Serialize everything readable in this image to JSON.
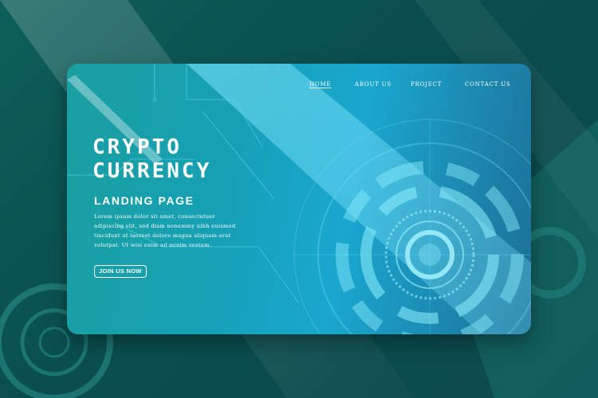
{
  "nav": {
    "items": [
      {
        "label": "HOME",
        "active": true
      },
      {
        "label": "ABOUT US",
        "active": false
      },
      {
        "label": "PROJECT",
        "active": false
      },
      {
        "label": "CONTACT US",
        "active": false
      }
    ]
  },
  "hero": {
    "title_line1": "CRYPTO",
    "title_line2": "CURRENCY",
    "subtitle": "LANDING PAGE",
    "body": "Lorem ipsum dolor sit amet, consectetuer adipiscing elit, sed diam nonummy nibh euismod tincidunt ut laoreet dolore magna aliquam erat volutpat. Ut wisi enim ad minim veniam.",
    "cta_label": "JOIN US NOW"
  },
  "colors": {
    "background": "#0b4f50",
    "card_teal": "#1a9fa0",
    "card_cyan": "#1aa7cf",
    "accent_light": "#5fd8f5",
    "text": "#ffffff"
  },
  "icons": {
    "hero_art": "tech-circle-icon",
    "circuit_lines": "circuit-lines-icon"
  }
}
